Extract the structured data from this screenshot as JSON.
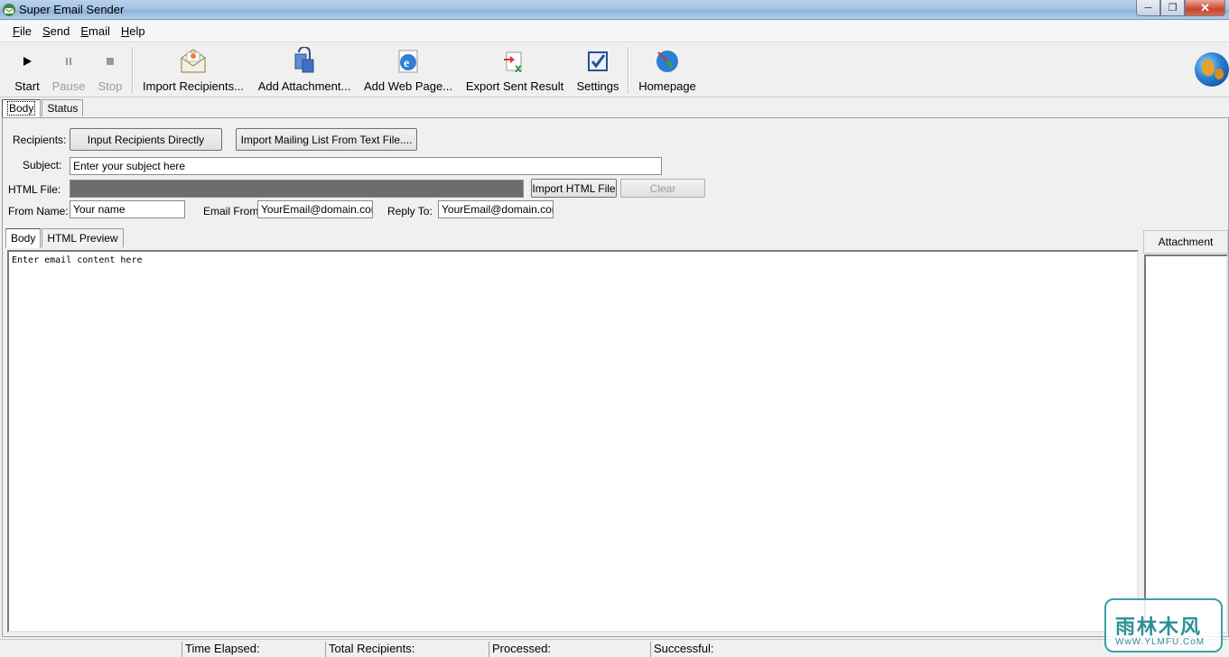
{
  "window": {
    "title": "Super Email Sender"
  },
  "menu": {
    "file": {
      "u": "F",
      "rest": "ile"
    },
    "send": {
      "u": "S",
      "rest": "end"
    },
    "email": {
      "u": "E",
      "rest": "mail"
    },
    "help": {
      "u": "H",
      "rest": "elp"
    }
  },
  "toolbar": {
    "start": "Start",
    "pause": "Pause",
    "stop": "Stop",
    "import_recipients": "Import Recipients...",
    "add_attachment": "Add Attachment...",
    "add_web_page": "Add Web Page...",
    "export_sent_result": "Export Sent Result",
    "settings": "Settings",
    "homepage": "Homepage"
  },
  "top_tabs": {
    "body": "Body",
    "status": "Status"
  },
  "form": {
    "recipients_label": "Recipients:",
    "input_recipients_btn": "Input Recipients Directly",
    "import_mailing_list_btn": "Import Mailing List From Text File....",
    "subject_label": "Subject:",
    "subject_value": "Enter your subject here",
    "html_file_label": "HTML File:",
    "import_html_btn": "Import HTML File",
    "clear_btn": "Clear",
    "from_name_label": "From Name:",
    "from_name_value": "Your name",
    "email_from_label": "Email From:",
    "email_from_value": "YourEmail@domain.com",
    "reply_to_label": "Reply To:",
    "reply_to_value": "YourEmail@domain.com"
  },
  "body_tabs": {
    "body": "Body",
    "html_preview": "HTML Preview"
  },
  "editor": {
    "content": "Enter email content here"
  },
  "attachment": {
    "header": "Attachment"
  },
  "statusbar": {
    "time_elapsed": "Time Elapsed:",
    "total_recipients": "Total Recipients:",
    "processed": "Processed:",
    "successful": "Successful:"
  },
  "watermark": {
    "top": "雨林木风",
    "bottom": "WwW.YLMFU.CoM"
  }
}
